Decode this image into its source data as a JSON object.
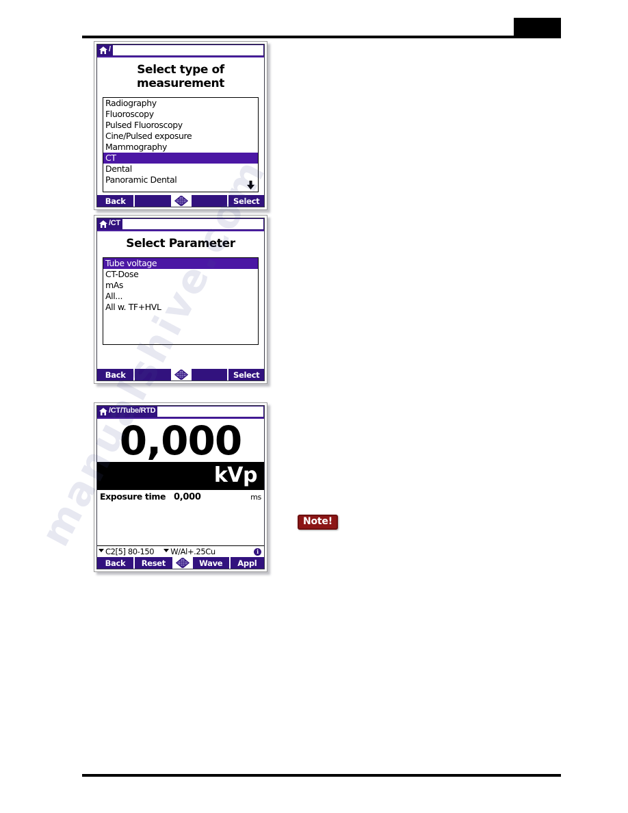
{
  "page": {
    "watermark_text": "manualshive.com",
    "note_badge": "Note!",
    "header_block_label": "header-black-block"
  },
  "screens": [
    {
      "id": "select-type-of-measurement",
      "titlebar": {
        "home_icon": "home-icon",
        "path": "/"
      },
      "heading": "Select type of measurement",
      "list": {
        "items": [
          "Radiography",
          "Fluoroscopy",
          "Pulsed Fluoroscopy",
          "Cine/Pulsed exposure",
          "Mammography",
          "CT",
          "Dental",
          "Panoramic Dental"
        ],
        "selected_index": 5,
        "more_arrow": "▼"
      },
      "softkeys": [
        {
          "label": "Back",
          "type": "key"
        },
        {
          "label": "",
          "type": "key"
        },
        {
          "label": "",
          "type": "navpad",
          "icon": "navpad-diamond-icon"
        },
        {
          "label": "",
          "type": "key"
        },
        {
          "label": "Select",
          "type": "key"
        }
      ]
    },
    {
      "id": "select-parameter",
      "titlebar": {
        "home_icon": "home-icon",
        "path": "/CT"
      },
      "heading": "Select Parameter",
      "list": {
        "items": [
          "Tube voltage",
          "CT-Dose",
          "mAs",
          "All...",
          "All w. TF+HVL"
        ],
        "selected_index": 0,
        "more_arrow": ""
      },
      "softkeys": [
        {
          "label": "Back",
          "type": "key"
        },
        {
          "label": "",
          "type": "key"
        },
        {
          "label": "",
          "type": "navpad",
          "icon": "navpad-diamond-icon"
        },
        {
          "label": "",
          "type": "key"
        },
        {
          "label": "Select",
          "type": "key"
        }
      ]
    },
    {
      "id": "measurement-readout",
      "titlebar": {
        "home_icon": "home-icon",
        "path": "/CT/Tube/RTD"
      },
      "reading": {
        "value": "0,000",
        "unit": "kVp"
      },
      "secondary": {
        "label": "Exposure time",
        "value": "0,000",
        "unit": "ms"
      },
      "status": {
        "detector": "C2[5] 80-150",
        "filter": "W/Al+.25Cu",
        "info_icon": "info-icon",
        "info_glyph": "i"
      },
      "softkeys": [
        {
          "label": "Back",
          "type": "key"
        },
        {
          "label": "Reset",
          "type": "key"
        },
        {
          "label": "",
          "type": "navpad",
          "icon": "navpad-diamond-icon"
        },
        {
          "label": "Wave",
          "type": "key"
        },
        {
          "label": "Appl",
          "type": "key"
        }
      ]
    }
  ],
  "colors": {
    "purple_dark": "#32127e",
    "purple_select": "#4b17a4",
    "note_red": "#8c1616",
    "black": "#000000",
    "white": "#ffffff"
  }
}
